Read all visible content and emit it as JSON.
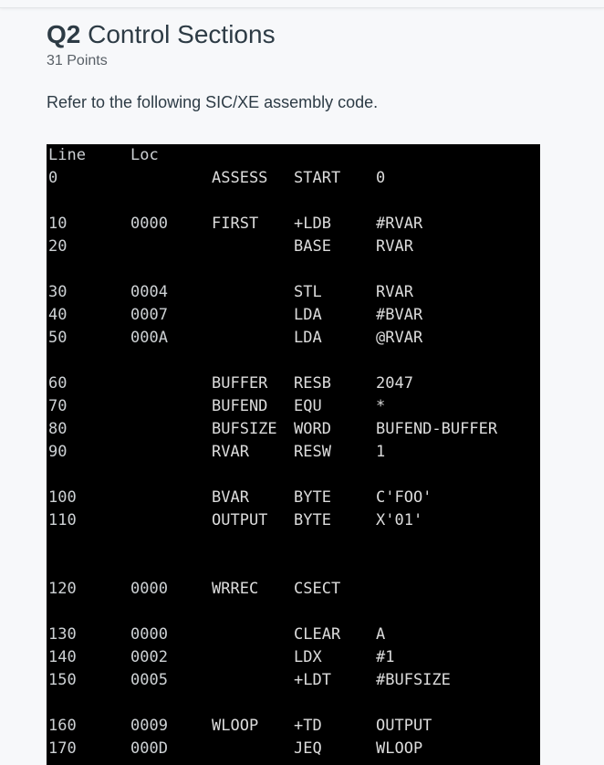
{
  "question": {
    "number": "Q2",
    "title": "Control Sections",
    "points": "31 Points",
    "prompt": "Refer to the following SIC/XE assembly code."
  },
  "code": {
    "header": {
      "line": "Line",
      "loc": "Loc"
    },
    "rows": [
      {
        "line": "0",
        "loc": "",
        "label": "ASSESS",
        "op": "START",
        "operand": "0"
      },
      {
        "line": "10",
        "loc": "0000",
        "label": "FIRST",
        "op": "+LDB",
        "operand": "#RVAR"
      },
      {
        "line": "20",
        "loc": "",
        "label": "",
        "op": "BASE",
        "operand": "RVAR"
      },
      {
        "line": "30",
        "loc": "0004",
        "label": "",
        "op": "STL",
        "operand": "RVAR"
      },
      {
        "line": "40",
        "loc": "0007",
        "label": "",
        "op": "LDA",
        "operand": "#BVAR"
      },
      {
        "line": "50",
        "loc": "000A",
        "label": "",
        "op": "LDA",
        "operand": "@RVAR"
      },
      {
        "line": "60",
        "loc": "",
        "label": "BUFFER",
        "op": "RESB",
        "operand": "2047"
      },
      {
        "line": "70",
        "loc": "",
        "label": "BUFEND",
        "op": "EQU",
        "operand": "*"
      },
      {
        "line": "80",
        "loc": "",
        "label": "BUFSIZE",
        "op": "WORD",
        "operand": "BUFEND-BUFFER"
      },
      {
        "line": "90",
        "loc": "",
        "label": "RVAR",
        "op": "RESW",
        "operand": "1"
      },
      {
        "line": "100",
        "loc": "",
        "label": "BVAR",
        "op": "BYTE",
        "operand": "C'FOO'"
      },
      {
        "line": "110",
        "loc": "",
        "label": "OUTPUT",
        "op": "BYTE",
        "operand": "X'01'"
      },
      {
        "line": "120",
        "loc": "0000",
        "label": "WRREC",
        "op": "CSECT",
        "operand": ""
      },
      {
        "line": "130",
        "loc": "0000",
        "label": "",
        "op": "CLEAR",
        "operand": "A"
      },
      {
        "line": "140",
        "loc": "0002",
        "label": "",
        "op": "LDX",
        "operand": "#1"
      },
      {
        "line": "150",
        "loc": "0005",
        "label": "",
        "op": "+LDT",
        "operand": "#BUFSIZE"
      },
      {
        "line": "160",
        "loc": "0009",
        "label": "WLOOP",
        "op": "+TD",
        "operand": "OUTPUT"
      },
      {
        "line": "170",
        "loc": "000D",
        "label": "",
        "op": "JEQ",
        "operand": "WLOOP"
      }
    ]
  }
}
